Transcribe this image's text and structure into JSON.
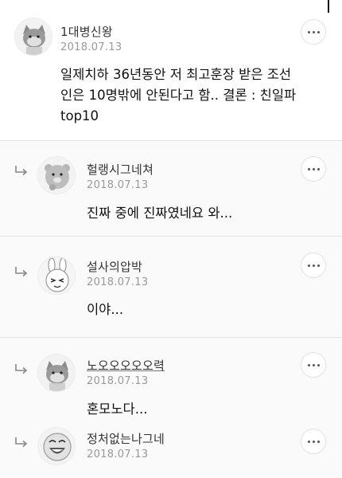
{
  "comments": [
    {
      "author": "1대병신왕",
      "date": "2018.07.13",
      "text": "일제치하 36년동안 저 최고훈장 받은 조선\n인은 10명밖에 안된다고 함.. 결론 : 친일파\ntop10",
      "avatar_icon": "cat-character-avatar-icon",
      "is_reply": false
    },
    {
      "author": "헐랭시그네쳐",
      "date": "2018.07.13",
      "text": "진짜 중에 진짜였네요 와...",
      "avatar_icon": "bear-character-avatar-icon",
      "is_reply": true
    },
    {
      "author": "설사의압박",
      "date": "2018.07.13",
      "text": "이야...",
      "avatar_icon": "rabbit-character-avatar-icon",
      "is_reply": true
    },
    {
      "author": "노오오오오오력",
      "date": "2018.07.13",
      "text": "혼모노다...",
      "avatar_icon": "cat-character-avatar-icon",
      "is_reply": true
    },
    {
      "author": "정처없는나그네",
      "date": "2018.07.13",
      "text": "",
      "avatar_icon": "laughing-face-avatar-icon",
      "is_reply": true
    }
  ],
  "icons": {
    "reply_arrow": "reply-arrow-icon",
    "more": "more-options-icon"
  },
  "colors": {
    "text": "#111111",
    "meta": "#999999",
    "divider": "#e3e3e3",
    "reply_bg": "#fafafa"
  }
}
